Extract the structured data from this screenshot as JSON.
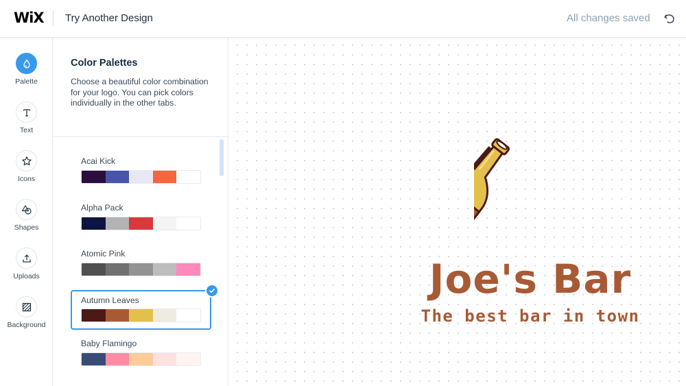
{
  "header": {
    "logo_text": "WiX",
    "try_another": "Try Another Design",
    "status": "All changes saved",
    "undo_icon": "undo-icon"
  },
  "rail": {
    "items": [
      {
        "label": "Palette",
        "icon": "palette-drop-icon",
        "active": true
      },
      {
        "label": "Text",
        "icon": "text-icon"
      },
      {
        "label": "Icons",
        "icon": "star-icon"
      },
      {
        "label": "Shapes",
        "icon": "shapes-icon"
      },
      {
        "label": "Uploads",
        "icon": "upload-icon"
      },
      {
        "label": "Background",
        "icon": "background-icon"
      }
    ]
  },
  "panel": {
    "title": "Color Palettes",
    "description": "Choose a beautiful color combination for your logo. You can pick colors individually in the other tabs.",
    "palettes": [
      {
        "name": "Acai Kick",
        "colors": [
          "#2a0e3d",
          "#4755a8",
          "#e6e9f4",
          "#f9633d",
          "#ffffff"
        ]
      },
      {
        "name": "Alpha Pack",
        "colors": [
          "#0b1442",
          "#b3b3b5",
          "#d8393a",
          "#f4f4f4",
          "#ffffff"
        ]
      },
      {
        "name": "Atomic Pink",
        "colors": [
          "#505050",
          "#717171",
          "#939393",
          "#bdbdbd",
          "#ff89bb"
        ]
      },
      {
        "name": "Autumn Leaves",
        "colors": [
          "#4b1916",
          "#a85a35",
          "#e3c04b",
          "#efebe1",
          "#ffffff"
        ],
        "selected": true
      },
      {
        "name": "Baby Flamingo",
        "colors": [
          "#394c78",
          "#ff8ba4",
          "#ffcc99",
          "#ffe1e0",
          "#fff4f2"
        ]
      }
    ]
  },
  "canvas": {
    "logo_name": "Joe's Bar",
    "tagline": "The best bar in town",
    "brand_color": "#a85a35"
  },
  "colors": {
    "accent": "#3899ec",
    "status_text": "#8fa3b8"
  }
}
